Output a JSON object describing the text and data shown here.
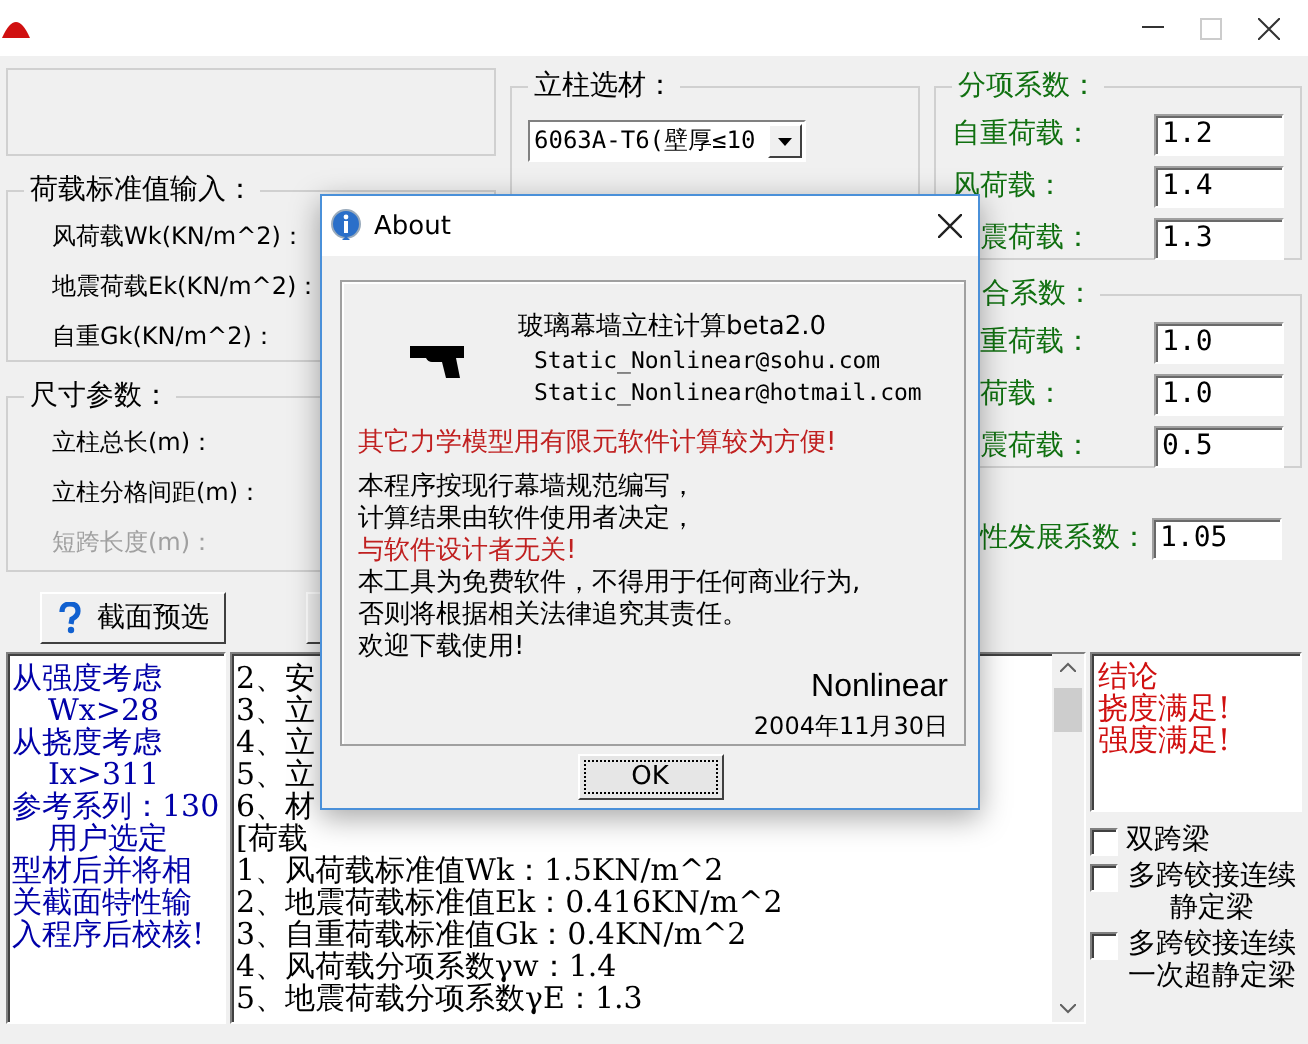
{
  "load_group": {
    "title": "荷载标准值输入：",
    "fields": [
      {
        "label": "风荷载Wk(KN/m^2)："
      },
      {
        "label": "地震荷载Ek(KN/m^2)："
      },
      {
        "label": "自重Gk(KN/m^2)："
      }
    ]
  },
  "size_group": {
    "title": "尺寸参数：",
    "fields": [
      {
        "label": "立柱总长(m)：",
        "disabled": false
      },
      {
        "label": "立柱分格间距(m)：",
        "disabled": false
      },
      {
        "label": "短跨长度(m)：",
        "disabled": true
      }
    ]
  },
  "preview_button": {
    "label": "截面预选"
  },
  "material": {
    "title": "立柱选材：",
    "value": "6063A-T6(壁厚≤10"
  },
  "partial_factors": {
    "title": {
      "text": "分项系数："
    },
    "rows": [
      {
        "label": "自重荷载：",
        "value": "1.2",
        "kind": "full"
      },
      {
        "label": "风荷载：",
        "value": "1.4",
        "kind": "full"
      },
      {
        "label": "震荷载：",
        "value": "1.3",
        "kind": "cut"
      }
    ]
  },
  "combination_factors": {
    "title": {
      "text": "合系数：",
      "kind": "cut"
    },
    "rows": [
      {
        "label": "重荷载：",
        "value": "1.0",
        "kind": "cut"
      },
      {
        "label": "荷载：",
        "value": "1.0",
        "kind": "cut"
      },
      {
        "label": "震荷载：",
        "value": "0.5",
        "kind": "cut"
      }
    ]
  },
  "plastic": {
    "label": "性发展系数：",
    "value": "1.05",
    "kind": "cut"
  },
  "advice": [
    {
      "text": "从强度考虑",
      "kind": "heading"
    },
    {
      "text": "Wx>28",
      "kind": "indented"
    },
    {
      "text": "从挠度考虑",
      "kind": "heading"
    },
    {
      "text": "Ix>311",
      "kind": "indented"
    },
    {
      "text": "参考系列：130",
      "kind": "heading"
    },
    {
      "text": "用户选定",
      "kind": "indented"
    },
    {
      "text": "型材后并将相",
      "kind": "heading"
    },
    {
      "text": "关截面特性输",
      "kind": "heading"
    },
    {
      "text": "入程序后校核!",
      "kind": "heading"
    }
  ],
  "report": [
    "2、安",
    "3、立",
    "4、立",
    "5、立",
    "6、材",
    "[荷载",
    "1、风荷载标准值Wk：1.5KN/m^2",
    "2、地震荷载标准值Ek：0.416KN/m^2",
    "3、自重荷载标准值Gk：0.4KN/m^2",
    "4、风荷载分项系数γw：1.4",
    "5、地震荷载分项系数γE：1.3"
  ],
  "conclusion": [
    "结论",
    "挠度满足!",
    "强度满足!"
  ],
  "beam_options": [
    {
      "label": "双跨梁",
      "checked": false
    },
    {
      "label": "多跨铰接连续静定梁",
      "checked": false
    },
    {
      "label": "多跨铰接连续一次超静定梁",
      "checked": false
    }
  ],
  "about": {
    "title": "About",
    "app": "玻璃幕墙立柱计算beta2.0",
    "emails": [
      "Static_Nonlinear@sohu.com",
      "Static_Nonlinear@hotmail.com"
    ],
    "notice": "其它力学模型用有限元软件计算较为方便!",
    "lines": [
      {
        "text": "本程序按现行幕墙规范编写，",
        "kind": "normal"
      },
      {
        "text": "计算结果由软件使用者决定，",
        "kind": "normal"
      },
      {
        "text": "与软件设计者无关!",
        "kind": "warning"
      },
      {
        "text": "本工具为免费软件，不得用于任何商业行为,",
        "kind": "normal"
      },
      {
        "text": "否则将根据相关法律追究其责任。",
        "kind": "normal"
      },
      {
        "text": "欢迎下载使用!",
        "kind": "normal"
      }
    ],
    "author": "Nonlinear",
    "date": "2004年11月30日",
    "ok": "OK"
  }
}
